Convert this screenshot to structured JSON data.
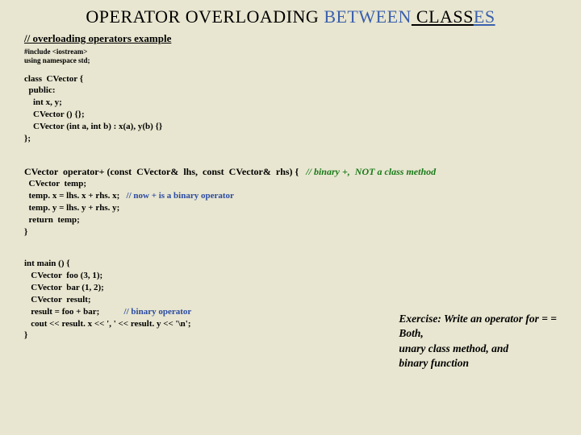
{
  "title": {
    "p1": "OPERATOR OVERLOADING ",
    "p2": "BETWEEN",
    "p3": " CLASS",
    "p4": "ES"
  },
  "subhead": "// overloading operators example",
  "includes": {
    "l1": "#include <iostream>",
    "l2": "using namespace std;"
  },
  "classblock": "class  CVector {\n  public:\n    int x, y;\n    CVector () {};\n    CVector (int a, int b) : x(a), y(b) {}\n};",
  "opfunc": {
    "sig": "CVector  operator+ (const  CVector&  lhs,  const  CVector&  rhs) {",
    "sig_comment": "   // binary +,  NOT a class method",
    "l2": "  CVector  temp;",
    "l3a": "  temp. x = lhs. x + rhs. x;",
    "l3b": "   // now + is a binary operator",
    "l4": "  temp. y = lhs. y + rhs. y;",
    "l5": "  return  temp;",
    "l6": "}"
  },
  "main": {
    "l1": "int main () {",
    "l2": "   CVector  foo (3, 1);",
    "l3": "   CVector  bar (1, 2);",
    "l4": "   CVector  result;",
    "l5a": "   result = foo + bar;",
    "l5b": "           // binary operator",
    "l6": "   cout << result. x << ', ' << result. y << '\\n';",
    "l7": "}"
  },
  "exercise": {
    "l1": "Exercise: Write an operator for = =",
    "l2": "         Both,",
    "l3": "             unary class method, and",
    "l4": "             binary function"
  }
}
